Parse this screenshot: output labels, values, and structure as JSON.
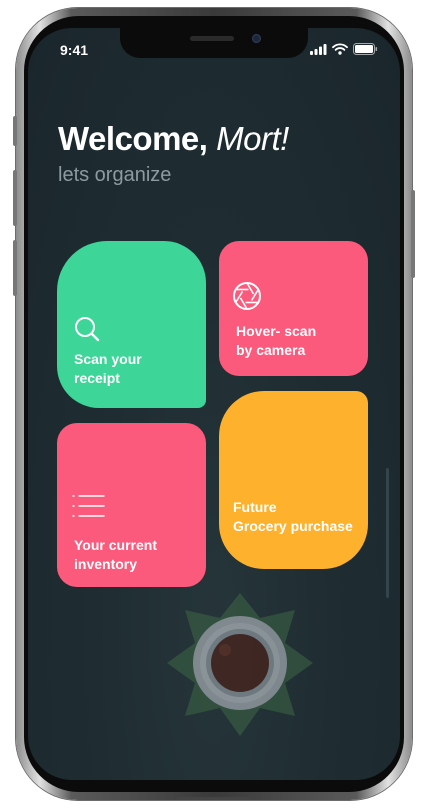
{
  "status_bar": {
    "time": "9:41"
  },
  "header": {
    "greeting": "Welcome,",
    "name": "Mort!",
    "subtitle": "lets organize"
  },
  "cards": [
    {
      "label": "Scan your\nreceipt",
      "color": "#3dd598",
      "icon": "search-icon"
    },
    {
      "label": "Hover- scan\nby camera",
      "color": "#fc5a7c",
      "icon": "camera-aperture-icon"
    },
    {
      "label": "Your current\ninventory",
      "color": "#fc5a7c",
      "icon": "list-icon"
    },
    {
      "label": "Future\nGrocery purchase",
      "color": "#fdb12c",
      "icon": ""
    }
  ],
  "colors": {
    "background": "#1f2d33",
    "green": "#3dd598",
    "pink": "#fc5a7c",
    "yellow": "#fdb12c"
  }
}
